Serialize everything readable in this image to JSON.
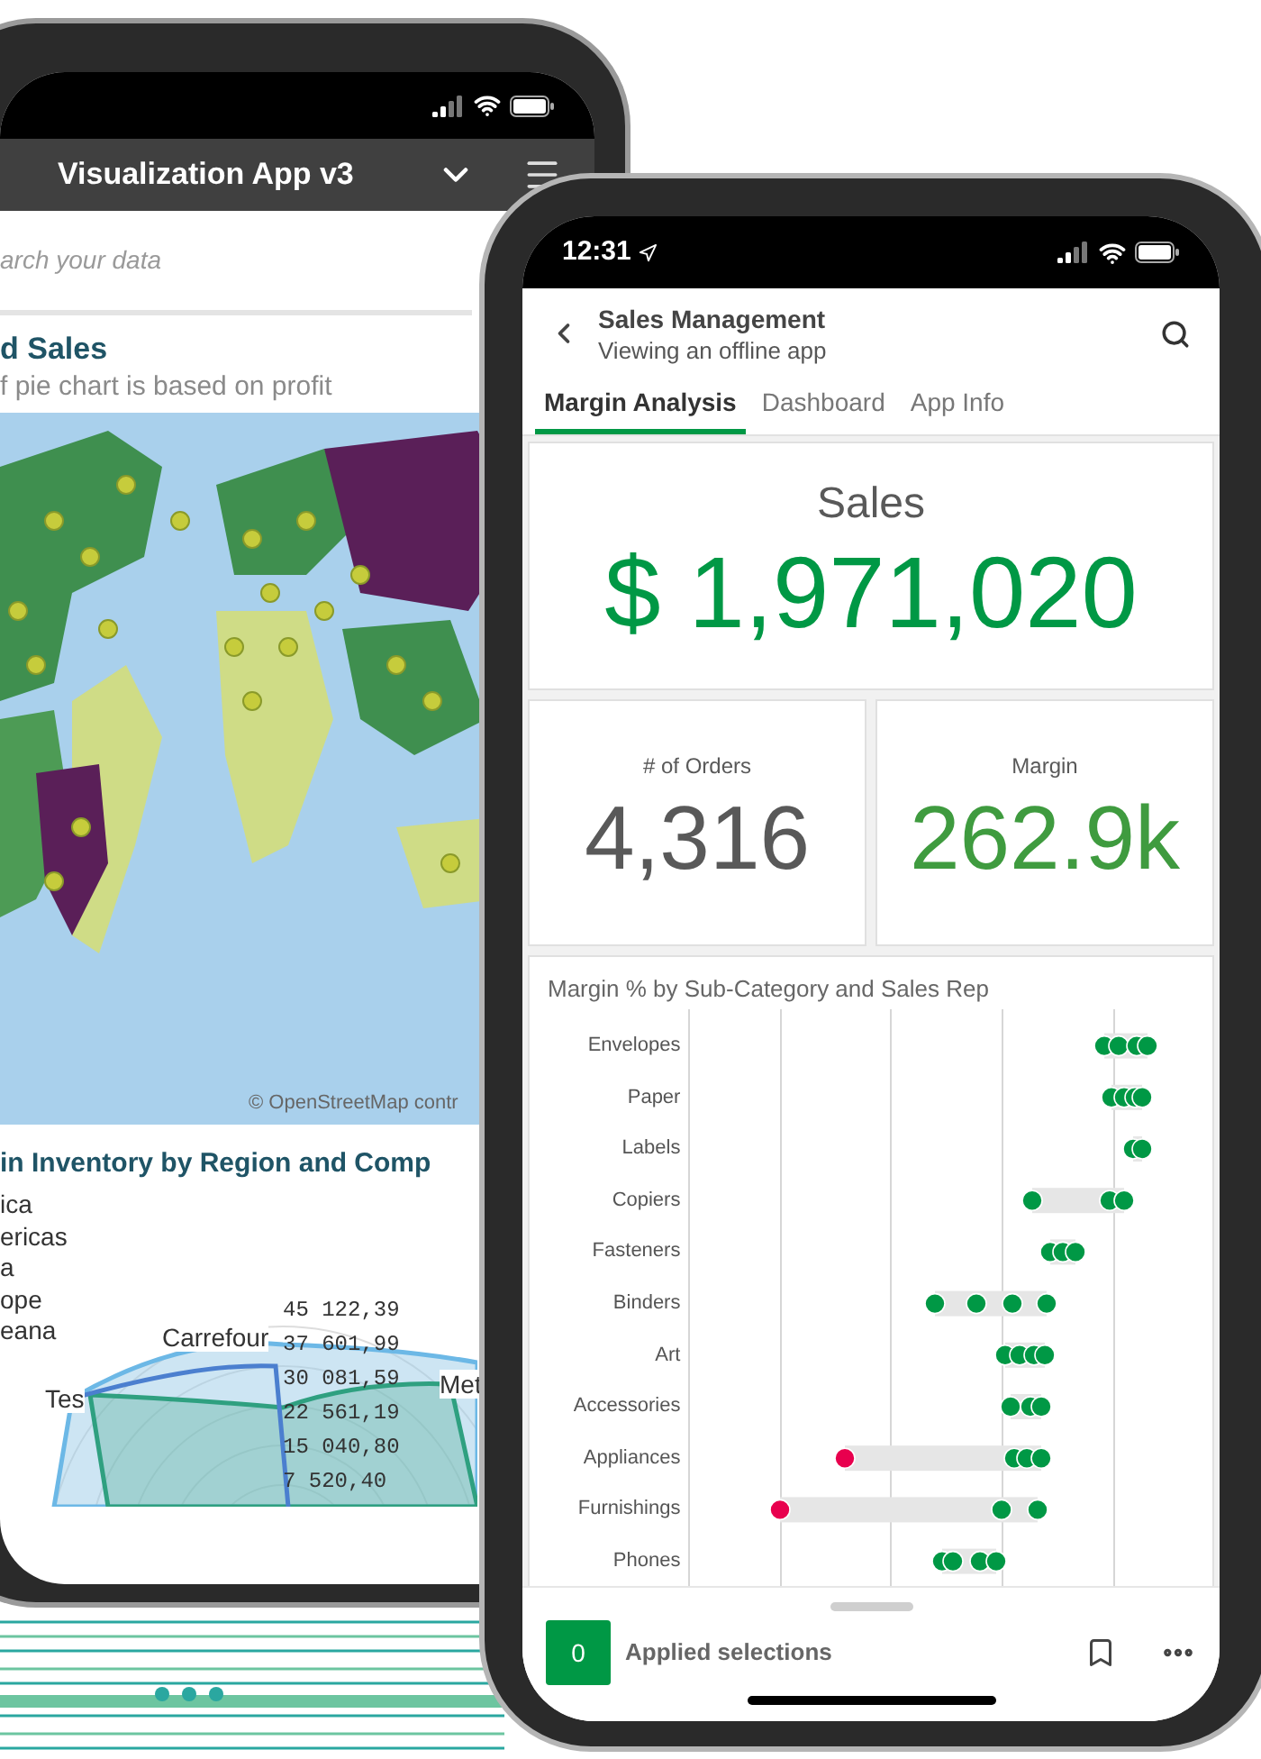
{
  "back_phone": {
    "header": {
      "title": "Visualization App v3"
    },
    "search": {
      "placeholder": "arch your data"
    },
    "map_panel": {
      "title": "d Sales",
      "subtitle": "f pie chart is based on profit",
      "attribution": "© OpenStreetMap contr"
    },
    "inventory_panel": {
      "title": "in Inventory by Region and Comp",
      "legend": [
        "ica",
        "ericas",
        "a",
        "ope",
        "eana"
      ],
      "category_labels": [
        "Carrefour",
        "Tes",
        "Met"
      ],
      "tick_labels": [
        "45 122,39",
        "37 601,99",
        "30 081,59",
        "22 561,19",
        "15 040,80",
        "7 520,40"
      ]
    }
  },
  "front_phone": {
    "status_bar": {
      "time": "12:31"
    },
    "header": {
      "title": "Sales Management",
      "subtitle": "Viewing an offline app"
    },
    "tabs": [
      {
        "label": "Margin Analysis",
        "selected": true
      },
      {
        "label": "Dashboard",
        "selected": false
      },
      {
        "label": "App Info",
        "selected": false
      }
    ],
    "kpis": [
      {
        "kind": "wide",
        "label": "Sales",
        "value": "$ 1,971,020",
        "color": "#009845"
      },
      {
        "kind": "half",
        "label": "# of Orders",
        "value": "4,316",
        "color": "#595959"
      },
      {
        "kind": "half",
        "label": "Margin",
        "value": "262.9k",
        "color": "#3f9b3f"
      }
    ],
    "chart": {
      "title": "Margin % by Sub-Category and Sales Rep",
      "row_labels": [
        "Envelopes",
        "Paper",
        "Labels",
        "Copiers",
        "Fasteners",
        "Binders",
        "Art",
        "Accessories",
        "Appliances",
        "Furnishings",
        "Phones"
      ]
    },
    "selections_bar": {
      "count": "0",
      "label": "Applied selections"
    }
  }
}
